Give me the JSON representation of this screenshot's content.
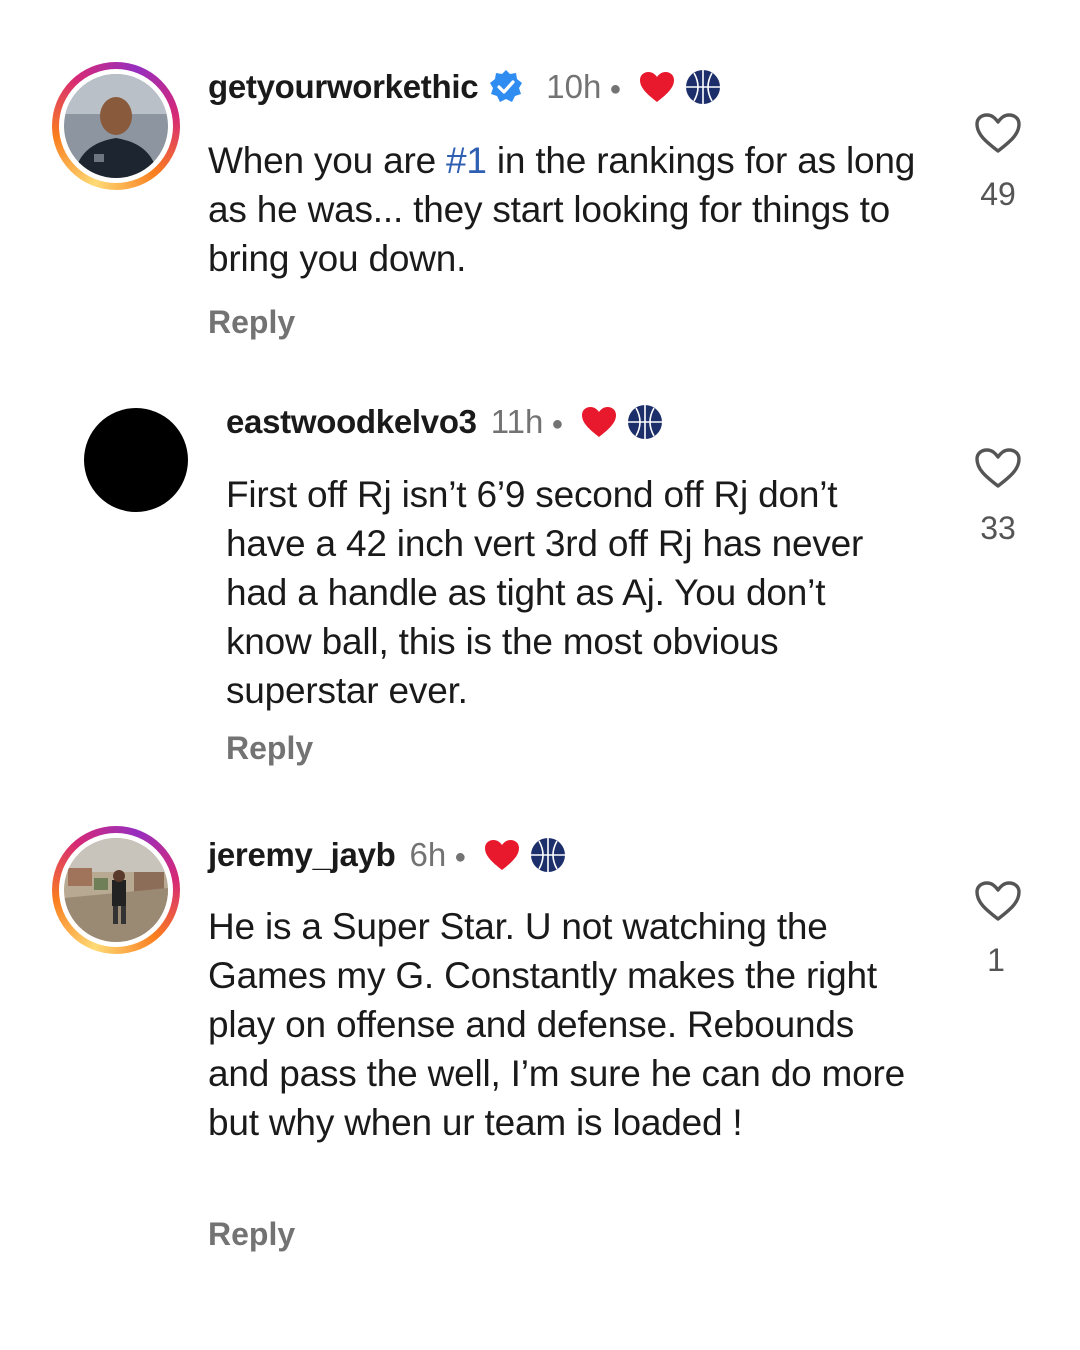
{
  "comments": [
    {
      "username": "getyourworkethic",
      "verified": true,
      "time": "10h",
      "text_before": "When you are ",
      "hashtag": "#1",
      "text_after": " in the rankings for as long as he was... they start looking for things to bring you down.",
      "reply_label": "Reply",
      "likes": "49"
    },
    {
      "username": "eastwoodkelvo3",
      "verified": false,
      "time": "11h",
      "text": "First off Rj isn’t 6’9 second off Rj don’t have a 42 inch vert 3rd off Rj has never had a handle as tight as Aj. You don’t know ball, this is the most obvious superstar ever.",
      "reply_label": "Reply",
      "likes": "33"
    },
    {
      "username": "jeremy_jayb",
      "verified": false,
      "time": "6h",
      "text": "He is a Super Star. U not watching the Games my G. Constantly makes the right play on offense and defense. Rebounds and pass the well, I’m sure he can do more but why when ur team is loaded !",
      "reply_label": "Reply",
      "likes": "1"
    }
  ],
  "icons": {
    "creator_heart": "heart-icon",
    "creator_avatar": "basketball-logo-icon",
    "like": "heart-outline-icon",
    "verified": "verified-badge-icon"
  },
  "colors": {
    "heart_red": "#e8192c",
    "verified_blue": "#2f8cf0",
    "hashtag_blue": "#2f5fb3",
    "muted": "#737373"
  }
}
